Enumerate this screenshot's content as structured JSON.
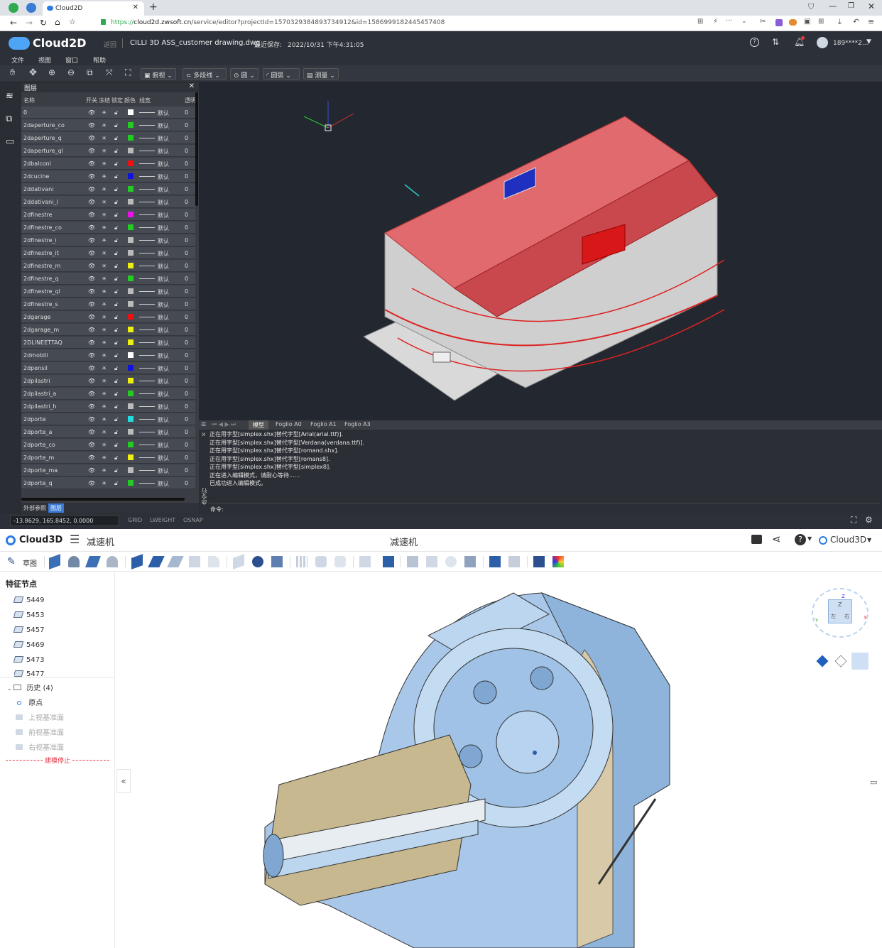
{
  "browser": {
    "tab_title": "Cloud2D",
    "url_prefix": "https://",
    "url_host": "cloud2d.zwsoft.cn",
    "url_path": "/service/editor?projectId=1570329384893734912&id=1586999182445457408"
  },
  "app2d": {
    "logo": "Cloud2D",
    "back_label": "返回",
    "file_name": "CILLI 3D ASS_customer drawing.dwg",
    "last_saved_label": "最近保存:",
    "last_saved_value": "2022/10/31 下午4:31:05",
    "user": "189****2...",
    "menu": [
      "文件",
      "视图",
      "窗口",
      "帮助"
    ],
    "view_dropdown": "俯视",
    "dropdowns": [
      "多段线",
      "圆",
      "圆弧",
      "测量"
    ],
    "layer_panel": {
      "title": "图层",
      "columns": [
        "名称",
        "开关",
        "冻结",
        "锁定",
        "颜色",
        "线宽",
        "透明"
      ],
      "rows": [
        {
          "name": "0",
          "color": "#ffffff"
        },
        {
          "name": "2daperture_co",
          "color": "#22cc22"
        },
        {
          "name": "2daperture_q",
          "color": "#22cc22"
        },
        {
          "name": "2daperture_ql",
          "color": "#bbbbbb"
        },
        {
          "name": "2dbalconi",
          "color": "#ee1111"
        },
        {
          "name": "2dcucine",
          "color": "#1111dd"
        },
        {
          "name": "2ddativani",
          "color": "#22cc22"
        },
        {
          "name": "2ddativani_l",
          "color": "#bbbbbb"
        },
        {
          "name": "2dfinestre",
          "color": "#ee11ee"
        },
        {
          "name": "2dfinestre_co",
          "color": "#22cc22"
        },
        {
          "name": "2dfinestre_i",
          "color": "#bbbbbb"
        },
        {
          "name": "2dfinestre_it",
          "color": "#bbbbbb"
        },
        {
          "name": "2dfinestre_m",
          "color": "#eeee11"
        },
        {
          "name": "2dfinestre_q",
          "color": "#22cc22"
        },
        {
          "name": "2dfinestre_ql",
          "color": "#bbbbbb"
        },
        {
          "name": "2dfinestre_s",
          "color": "#bbbbbb"
        },
        {
          "name": "2dgarage",
          "color": "#ee1111"
        },
        {
          "name": "2dgarage_m",
          "color": "#eeee11"
        },
        {
          "name": "2DLINEETTAQ",
          "color": "#eeee11"
        },
        {
          "name": "2dmobili",
          "color": "#ffffff"
        },
        {
          "name": "2dpensil",
          "color": "#1111dd"
        },
        {
          "name": "2dpilastri",
          "color": "#eeee11"
        },
        {
          "name": "2dpilastri_a",
          "color": "#22cc22"
        },
        {
          "name": "2dpilastri_h",
          "color": "#bbbbbb"
        },
        {
          "name": "2dporte",
          "color": "#22dddd"
        },
        {
          "name": "2dporte_a",
          "color": "#bbbbbb"
        },
        {
          "name": "2dporte_co",
          "color": "#22cc22"
        },
        {
          "name": "2dporte_m",
          "color": "#eeee11"
        },
        {
          "name": "2dporte_ma",
          "color": "#bbbbbb"
        },
        {
          "name": "2dporte_q",
          "color": "#22cc22"
        }
      ],
      "linetype_label": "默认",
      "transparency": "0",
      "bottom_tabs": [
        "外部参照",
        "图层"
      ]
    },
    "sheet_tabs": [
      "模型",
      "Foglio A0",
      "Foglio A1",
      "Foglio A3"
    ],
    "command_lines": [
      "正在用字型[simplex.shx]替代字型[Arial(arial.ttf)].",
      "正在用字型[simplex.shx]替代字型[Verdana(verdana.ttf)].",
      "正在用字型[simplex.shx]替代字型[romand.shx].",
      "正在用字型[simplex.shx]替代字型[romans8].",
      "正在用字型[simplex.shx]替代字型[simplex8].",
      "正在进入编辑模式，请耐心等待......",
      "已成功进入编辑模式。"
    ],
    "command_side_label": "命令行",
    "command_prompt": "命令:",
    "coords": "-13.8629,  165.8452,  0.0000",
    "status_toggles": [
      "GRID",
      "LWEIGHT",
      "OSNAP"
    ]
  },
  "app3d": {
    "logo": "Cloud3D",
    "title": "减速机",
    "user": "Cloud3D",
    "sketch_label": "草图",
    "tree_title": "特征节点",
    "nodes": [
      "5449",
      "5453",
      "5457",
      "5469",
      "5473",
      "5477"
    ],
    "history_label": "历史 (4)",
    "history_items": [
      "原点",
      "上视基准面",
      "前视基准面",
      "右视基准面"
    ],
    "stop_label": "建模停止",
    "collapse_icon": "«",
    "viewcube": {
      "face": "Z",
      "side_left": "左",
      "side_right": "右",
      "axes": [
        "X",
        "Y",
        "Z"
      ]
    }
  }
}
